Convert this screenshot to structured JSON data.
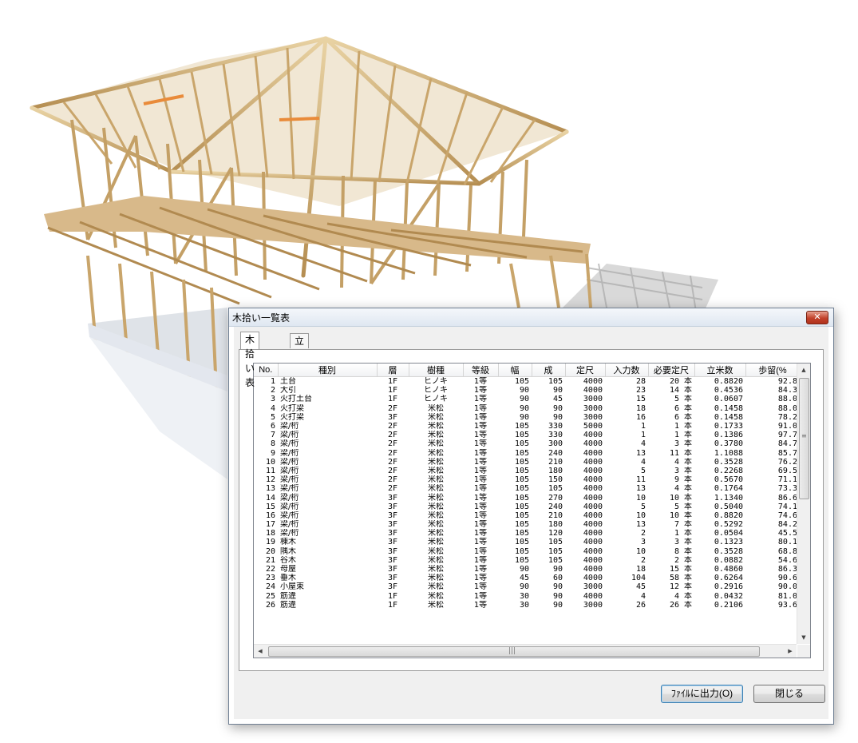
{
  "dialog": {
    "title": "木拾い一覧表",
    "close_label": "✕",
    "tabs": [
      {
        "label": "木拾い表",
        "active": true
      },
      {
        "label": "立米表",
        "active": false
      }
    ],
    "buttons": {
      "export_label": "ﾌｧｲﾙに出力(O)",
      "close_label": "閉じる"
    }
  },
  "table": {
    "columns": [
      "No.",
      "種別",
      "層",
      "樹種",
      "等級",
      "幅",
      "成",
      "定尺",
      "入力数",
      "必要定尺",
      "立米数",
      "歩留(%"
    ],
    "rows": [
      [
        "1",
        "土台",
        "1F",
        "ヒノキ",
        "1等",
        "105",
        "105",
        "4000",
        "28",
        "20 本",
        "0.8820",
        "92.8"
      ],
      [
        "2",
        "大引",
        "1F",
        "ヒノキ",
        "1等",
        "90",
        "90",
        "4000",
        "23",
        "14 本",
        "0.4536",
        "84.3"
      ],
      [
        "3",
        "火打土台",
        "1F",
        "ヒノキ",
        "1等",
        "90",
        "45",
        "3000",
        "15",
        "5 本",
        "0.0607",
        "88.0"
      ],
      [
        "4",
        "火打梁",
        "2F",
        "米松",
        "1等",
        "90",
        "90",
        "3000",
        "18",
        "6 本",
        "0.1458",
        "88.0"
      ],
      [
        "5",
        "火打梁",
        "3F",
        "米松",
        "1等",
        "90",
        "90",
        "3000",
        "16",
        "6 本",
        "0.1458",
        "78.2"
      ],
      [
        "6",
        "梁/桁",
        "2F",
        "米松",
        "1等",
        "105",
        "330",
        "5000",
        "1",
        "1 本",
        "0.1733",
        "91.0"
      ],
      [
        "7",
        "梁/桁",
        "2F",
        "米松",
        "1等",
        "105",
        "330",
        "4000",
        "1",
        "1 本",
        "0.1386",
        "97.7"
      ],
      [
        "8",
        "梁/桁",
        "2F",
        "米松",
        "1等",
        "105",
        "300",
        "4000",
        "4",
        "3 本",
        "0.3780",
        "84.7"
      ],
      [
        "9",
        "梁/桁",
        "2F",
        "米松",
        "1等",
        "105",
        "240",
        "4000",
        "13",
        "11 本",
        "1.1088",
        "85.7"
      ],
      [
        "10",
        "梁/桁",
        "2F",
        "米松",
        "1等",
        "105",
        "210",
        "4000",
        "4",
        "4 本",
        "0.3528",
        "76.2"
      ],
      [
        "11",
        "梁/桁",
        "2F",
        "米松",
        "1等",
        "105",
        "180",
        "4000",
        "5",
        "3 本",
        "0.2268",
        "69.5"
      ],
      [
        "12",
        "梁/桁",
        "2F",
        "米松",
        "1等",
        "105",
        "150",
        "4000",
        "11",
        "9 本",
        "0.5670",
        "71.1"
      ],
      [
        "13",
        "梁/桁",
        "2F",
        "米松",
        "1等",
        "105",
        "105",
        "4000",
        "13",
        "4 本",
        "0.1764",
        "73.3"
      ],
      [
        "14",
        "梁/桁",
        "3F",
        "米松",
        "1等",
        "105",
        "270",
        "4000",
        "10",
        "10 本",
        "1.1340",
        "86.6"
      ],
      [
        "15",
        "梁/桁",
        "3F",
        "米松",
        "1等",
        "105",
        "240",
        "4000",
        "5",
        "5 本",
        "0.5040",
        "74.1"
      ],
      [
        "16",
        "梁/桁",
        "3F",
        "米松",
        "1等",
        "105",
        "210",
        "4000",
        "10",
        "10 本",
        "0.8820",
        "74.6"
      ],
      [
        "17",
        "梁/桁",
        "3F",
        "米松",
        "1等",
        "105",
        "180",
        "4000",
        "13",
        "7 本",
        "0.5292",
        "84.2"
      ],
      [
        "18",
        "梁/桁",
        "3F",
        "米松",
        "1等",
        "105",
        "120",
        "4000",
        "2",
        "1 本",
        "0.0504",
        "45.5"
      ],
      [
        "19",
        "棟木",
        "3F",
        "米松",
        "1等",
        "105",
        "105",
        "4000",
        "3",
        "3 本",
        "0.1323",
        "80.1"
      ],
      [
        "20",
        "隅木",
        "3F",
        "米松",
        "1等",
        "105",
        "105",
        "4000",
        "10",
        "8 本",
        "0.3528",
        "68.8"
      ],
      [
        "21",
        "谷木",
        "3F",
        "米松",
        "1等",
        "105",
        "105",
        "4000",
        "2",
        "2 本",
        "0.0882",
        "54.6"
      ],
      [
        "22",
        "母屋",
        "3F",
        "米松",
        "1等",
        "90",
        "90",
        "4000",
        "18",
        "15 本",
        "0.4860",
        "86.3"
      ],
      [
        "23",
        "垂木",
        "3F",
        "米松",
        "1等",
        "45",
        "60",
        "4000",
        "104",
        "58 本",
        "0.6264",
        "90.6"
      ],
      [
        "24",
        "小屋束",
        "3F",
        "米松",
        "1等",
        "90",
        "90",
        "3000",
        "45",
        "12 本",
        "0.2916",
        "90.0"
      ],
      [
        "25",
        "筋違",
        "1F",
        "米松",
        "1等",
        "30",
        "90",
        "4000",
        "4",
        "4 本",
        "0.0432",
        "81.0"
      ],
      [
        "26",
        "筋違",
        "1F",
        "米松",
        "1等",
        "30",
        "90",
        "3000",
        "26",
        "26 本",
        "0.2106",
        "93.6"
      ]
    ],
    "scroll_grip": "≡",
    "hscroll_grip": "|||"
  }
}
